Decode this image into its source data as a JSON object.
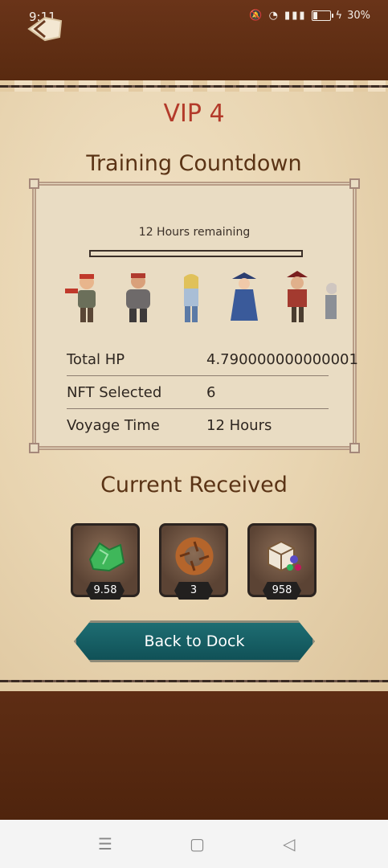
{
  "status_bar": {
    "time": "9:11",
    "battery_pct": "30%",
    "battery_level": 0.3
  },
  "page": {
    "vip_label": "VIP 4",
    "training_title": "Training Countdown",
    "received_title": "Current Received"
  },
  "countdown": {
    "remaining_text": "12 Hours remaining",
    "progress": 0
  },
  "crew": [
    "pirate-1",
    "pirate-2",
    "pirate-3",
    "pirate-4",
    "pirate-5",
    "pirate-6"
  ],
  "stats": [
    {
      "label": "Total HP",
      "value": "4.790000000000001"
    },
    {
      "label": "NFT Selected",
      "value": "6"
    },
    {
      "label": "Voyage Time",
      "value": "12 Hours"
    }
  ],
  "rewards": [
    {
      "icon": "green-crystal-icon",
      "value": "9.58"
    },
    {
      "icon": "wood-ring-icon",
      "value": "3"
    },
    {
      "icon": "gem-cube-icon",
      "value": "958"
    }
  ],
  "actions": {
    "back_to_dock": "Back to Dock"
  },
  "colors": {
    "vip": "#b33a2a",
    "button": "#1f6f74",
    "wood": "#5e2e15"
  }
}
